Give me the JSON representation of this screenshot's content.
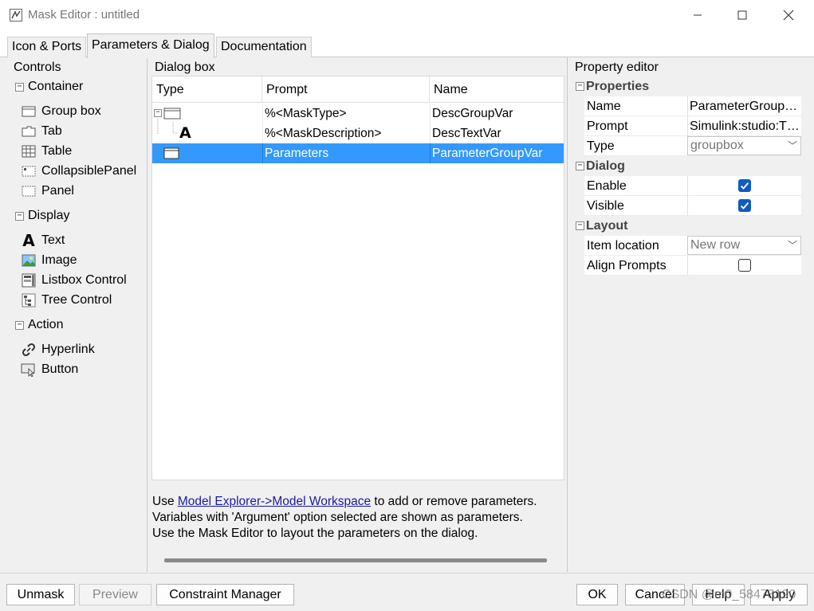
{
  "window": {
    "title": "Mask Editor : untitled",
    "controls": [
      "minimize",
      "maximize",
      "close"
    ]
  },
  "tabs": [
    {
      "label": "Icon & Ports",
      "active": false
    },
    {
      "label": "Parameters & Dialog",
      "active": true
    },
    {
      "label": "Documentation",
      "active": false
    }
  ],
  "controls_panel": {
    "title": "Controls",
    "groups": [
      {
        "label": "Container",
        "items": [
          {
            "label": "Group box",
            "icon": "groupbox-icon"
          },
          {
            "label": "Tab",
            "icon": "tab-icon"
          },
          {
            "label": "Table",
            "icon": "table-icon"
          },
          {
            "label": "CollapsiblePanel",
            "icon": "collapsible-panel-icon"
          },
          {
            "label": "Panel",
            "icon": "panel-icon"
          }
        ]
      },
      {
        "label": "Display",
        "items": [
          {
            "label": "Text",
            "icon": "text-icon"
          },
          {
            "label": "Image",
            "icon": "image-icon"
          },
          {
            "label": "Listbox Control",
            "icon": "listbox-icon"
          },
          {
            "label": "Tree Control",
            "icon": "tree-icon"
          }
        ]
      },
      {
        "label": "Action",
        "items": [
          {
            "label": "Hyperlink",
            "icon": "hyperlink-icon"
          },
          {
            "label": "Button",
            "icon": "button-icon"
          }
        ]
      }
    ]
  },
  "dialog_box": {
    "title": "Dialog box",
    "columns": [
      "Type",
      "Prompt",
      "Name"
    ],
    "rows": [
      {
        "prompt": "%<MaskType>",
        "name": "DescGroupVar",
        "selected": false
      },
      {
        "prompt": "%<MaskDescription>",
        "name": "DescTextVar",
        "selected": false
      },
      {
        "prompt": "Parameters",
        "name": "ParameterGroupVar",
        "selected": true
      }
    ],
    "info": {
      "line1_prefix": "Use ",
      "link1": "Model Explorer->Model Workspace",
      "line1_suffix": " to add or remove parameters.",
      "line2": "Variables with 'Argument' option selected are shown as parameters.",
      "line3": "Use the Mask Editor to layout the parameters on the dialog."
    }
  },
  "property_editor": {
    "title": "Property editor",
    "groups": {
      "properties": {
        "label": "Properties",
        "name_label": "Name",
        "name_value": "ParameterGroup…",
        "prompt_label": "Prompt",
        "prompt_value": "Simulink:studio:T…",
        "type_label": "Type",
        "type_value": "groupbox"
      },
      "dialog": {
        "label": "Dialog",
        "enable_label": "Enable",
        "enable_checked": true,
        "visible_label": "Visible",
        "visible_checked": true
      },
      "layout": {
        "label": "Layout",
        "item_location_label": "Item location",
        "item_location_value": "New row",
        "align_prompts_label": "Align Prompts",
        "align_prompts_checked": false
      }
    }
  },
  "buttons": {
    "unmask": "Unmask",
    "preview": "Preview",
    "constraint_manager": "Constraint Manager",
    "ok": "OK",
    "cancel": "Cancel",
    "help": "Help",
    "apply": "Apply"
  },
  "watermark": "CSDN @m0_58473190",
  "colors": {
    "selection": "#3399ff",
    "checkbox": "#0f5cc0",
    "link": "#1a1aa6"
  }
}
